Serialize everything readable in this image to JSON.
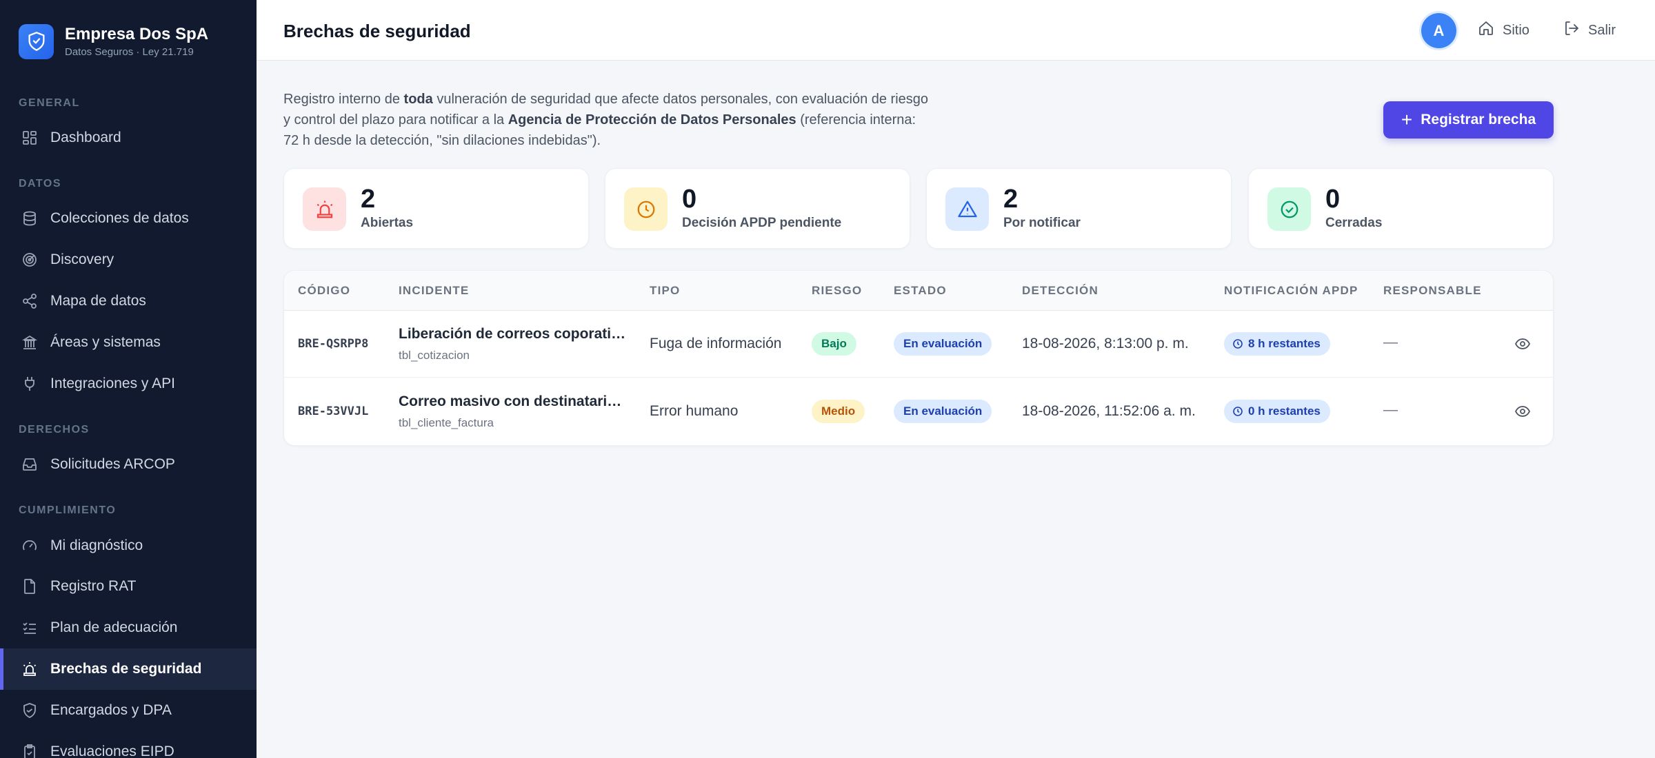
{
  "brand": {
    "name": "Empresa Dos SpA",
    "subtitle": "Datos Seguros · Ley 21.719"
  },
  "sidebar": {
    "sections": {
      "general": "GENERAL",
      "datos": "DATOS",
      "derechos": "DERECHOS",
      "cumplimiento": "CUMPLIMIENTO"
    },
    "items": [
      {
        "label": "Dashboard",
        "icon": "grid-icon"
      },
      {
        "label": "Colecciones de datos",
        "icon": "database-icon"
      },
      {
        "label": "Discovery",
        "icon": "radar-icon"
      },
      {
        "label": "Mapa de datos",
        "icon": "share-nodes-icon"
      },
      {
        "label": "Áreas y sistemas",
        "icon": "building-icon"
      },
      {
        "label": "Integraciones y API",
        "icon": "plug-icon"
      },
      {
        "label": "Solicitudes ARCOP",
        "icon": "inbox-icon"
      },
      {
        "label": "Mi diagnóstico",
        "icon": "gauge-icon"
      },
      {
        "label": "Registro RAT",
        "icon": "file-icon"
      },
      {
        "label": "Plan de adecuación",
        "icon": "checklist-icon"
      },
      {
        "label": "Brechas de seguridad",
        "icon": "siren-icon",
        "active": true
      },
      {
        "label": "Encargados y DPA",
        "icon": "shield-handshake-icon"
      },
      {
        "label": "Evaluaciones EIPD",
        "icon": "clipboard-check-icon"
      }
    ]
  },
  "header": {
    "title": "Brechas de seguridad",
    "avatar": "A",
    "site_label": "Sitio",
    "logout_label": "Salir"
  },
  "intro": {
    "p1": "Registro interno de ",
    "b1": "toda",
    "p2": " vulneración de seguridad que afecte datos personales, con evaluación de riesgo y control del plazo para notificar a la ",
    "b2": "Agencia de Protección de Datos Personales",
    "p3": " (referencia interna: 72 h desde la detección, \"sin dilaciones indebidas\")."
  },
  "actions": {
    "register_label": "Registrar brecha"
  },
  "stats": [
    {
      "value": "2",
      "label": "Abiertas",
      "icon": "siren-icon",
      "color": "#ef4444",
      "bg": "#fee2e2"
    },
    {
      "value": "0",
      "label": "Decisión APDP pendiente",
      "icon": "clock-icon",
      "color": "#d97706",
      "bg": "#fef3c7"
    },
    {
      "value": "2",
      "label": "Por notificar",
      "icon": "warning-icon",
      "color": "#2563eb",
      "bg": "#dbeafe"
    },
    {
      "value": "0",
      "label": "Cerradas",
      "icon": "check-circle-icon",
      "color": "#059669",
      "bg": "#d1fae5"
    }
  ],
  "table": {
    "columns": [
      "CÓDIGO",
      "INCIDENTE",
      "TIPO",
      "RIESGO",
      "ESTADO",
      "DETECCIÓN",
      "NOTIFICACIÓN APDP",
      "RESPONSABLE"
    ],
    "rows": [
      {
        "code": "BRE-QSRPP8",
        "title": "Liberación de correos coporativos",
        "table": "tbl_cotizacion",
        "type": "Fuga de información",
        "risk": "Bajo",
        "status": "En evaluación",
        "detected": "18-08-2026, 8:13:00 p. m.",
        "notification": "8 h restantes",
        "owner": "—"
      },
      {
        "code": "BRE-53VVJL",
        "title": "Correo masivo con destinatarios visibles",
        "table": "tbl_cliente_factura",
        "type": "Error humano",
        "risk": "Medio",
        "status": "En evaluación",
        "detected": "18-08-2026, 11:52:06 a. m.",
        "notification": "0 h restantes",
        "owner": "—"
      }
    ]
  }
}
